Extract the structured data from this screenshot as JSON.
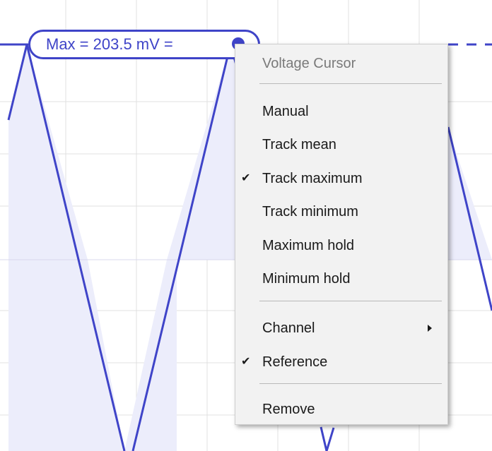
{
  "cursor": {
    "label": "Max = 203.5 mV =",
    "color": "#3f44c8"
  },
  "waveform": {
    "line_color": "#3f44c8",
    "fill_color": "#ecedfb",
    "grid_color": "#e1e1e1"
  },
  "menu": {
    "title": "Voltage Cursor",
    "items": [
      {
        "label": "Manual",
        "checked": false
      },
      {
        "label": "Track mean",
        "checked": false
      },
      {
        "label": "Track maximum",
        "checked": true
      },
      {
        "label": "Track minimum",
        "checked": false
      },
      {
        "label": "Maximum hold",
        "checked": false
      },
      {
        "label": "Minimum hold",
        "checked": false
      }
    ],
    "channel_label": "Channel",
    "reference_label": "Reference",
    "reference_checked": true,
    "remove_label": "Remove",
    "check_icon": "checkmark-icon",
    "submenu_icon": "chevron-right-icon"
  }
}
